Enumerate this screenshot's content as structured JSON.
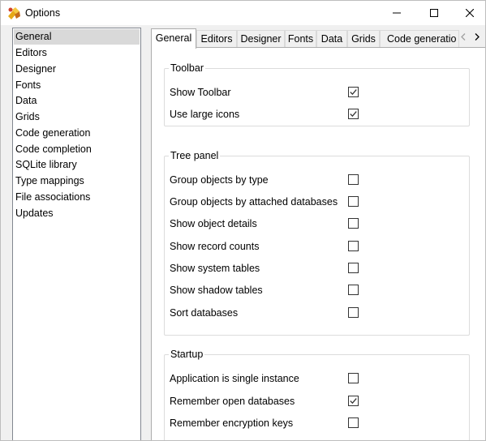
{
  "window": {
    "title": "Options",
    "icons": {
      "app": "app-logo-icon",
      "minimize": "minimize-icon",
      "maximize": "maximize-icon",
      "close": "close-icon"
    }
  },
  "nav": {
    "selected": "General",
    "items": [
      "General",
      "Editors",
      "Designer",
      "Fonts",
      "Data",
      "Grids",
      "Code generation",
      "Code completion",
      "SQLite library",
      "Type mappings",
      "File associations",
      "Updates"
    ]
  },
  "tabs": {
    "active": "General",
    "items": [
      "General",
      "Editors",
      "Designer",
      "Fonts",
      "Data",
      "Grids",
      "Code generatio"
    ],
    "scroll_left_icon": "chevron-left-icon",
    "scroll_right_icon": "chevron-right-icon"
  },
  "groups": [
    {
      "title": "Toolbar",
      "options": [
        {
          "label": "Show Toolbar",
          "checked": true
        },
        {
          "label": "Use large icons",
          "checked": true
        }
      ]
    },
    {
      "title": "Tree panel",
      "options": [
        {
          "label": "Group objects by type",
          "checked": false
        },
        {
          "label": "Group objects by attached databases",
          "checked": false
        },
        {
          "label": "Show object details",
          "checked": false
        },
        {
          "label": "Show record counts",
          "checked": false
        },
        {
          "label": "Show system tables",
          "checked": false
        },
        {
          "label": "Show shadow tables",
          "checked": false
        },
        {
          "label": "Sort databases",
          "checked": false
        }
      ]
    },
    {
      "title": "Startup",
      "options": [
        {
          "label": "Application is single instance",
          "checked": false
        },
        {
          "label": "Remember open databases",
          "checked": true
        },
        {
          "label": "Remember encryption keys",
          "checked": false
        }
      ]
    }
  ],
  "colors": {
    "selection": "#d9d9d9",
    "check_mark": "#333333",
    "border": "#adadad"
  }
}
